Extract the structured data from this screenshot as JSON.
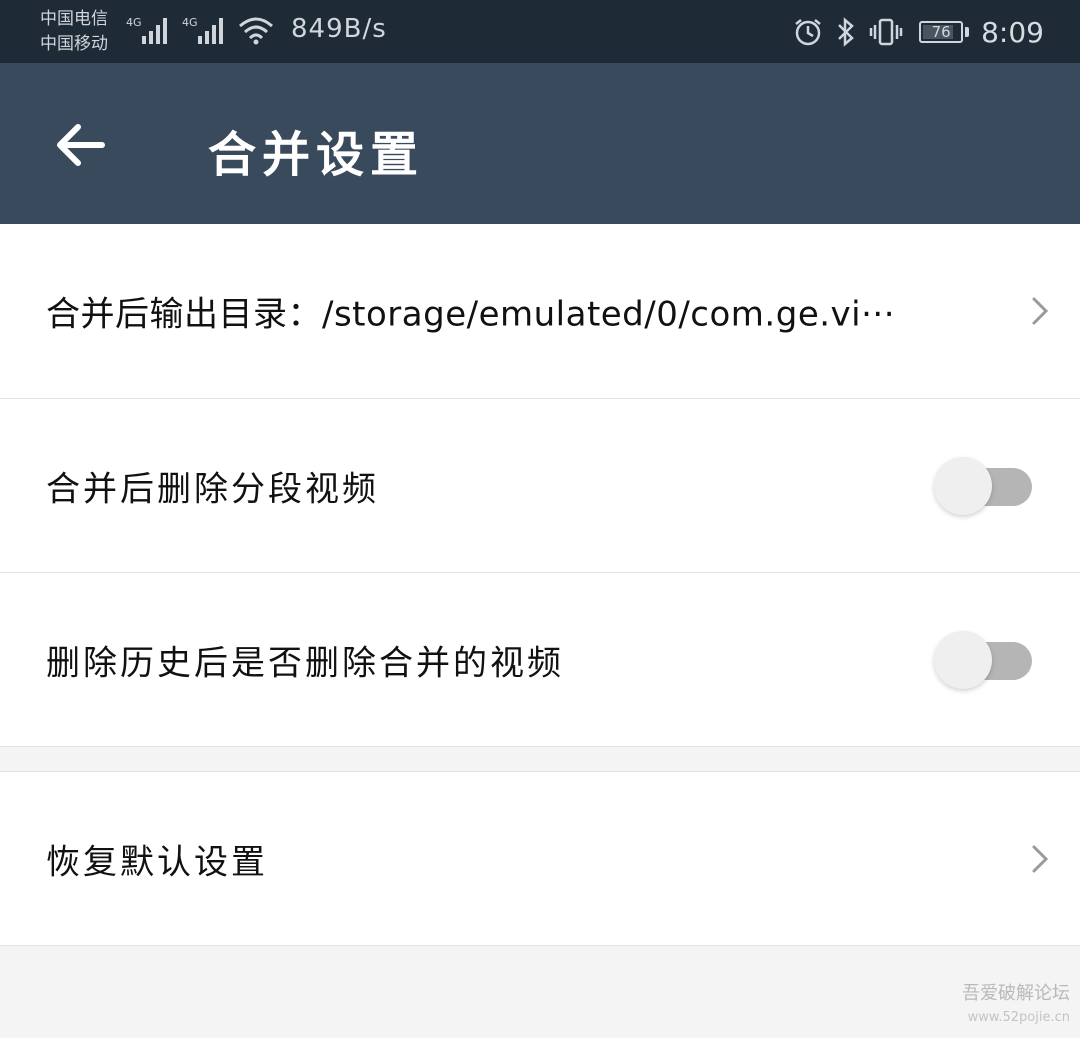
{
  "status_bar": {
    "carrier_1": "中国电信",
    "carrier_2": "中国移动",
    "network_1": "4G",
    "network_2": "4G",
    "net_speed": "849B/s",
    "battery_level": "76",
    "time": "8:09",
    "icons": [
      "signal-icon",
      "signal-icon",
      "wifi-icon",
      "alarm-icon",
      "bluetooth-icon",
      "vibrate-icon",
      "battery-icon"
    ]
  },
  "app_bar": {
    "title": "合并设置",
    "back_icon": "back-arrow-icon"
  },
  "settings": {
    "output_dir_label": "合并后输出目录：/storage/emulated/0/com.ge.vi···",
    "delete_segments_label": "合并后删除分段视频",
    "delete_segments_enabled": false,
    "delete_merged_label": "删除历史后是否删除合并的视频",
    "delete_merged_enabled": false,
    "restore_defaults_label": "恢复默认设置"
  },
  "watermark": {
    "line1": "吾爱破解论坛",
    "line2": "www.52pojie.cn"
  },
  "colors": {
    "status_bar_bg": "#1e2a36",
    "app_bar_bg": "#394a5d",
    "page_bg": "#f4f4f4",
    "switch_off_track": "#b5b5b5"
  }
}
